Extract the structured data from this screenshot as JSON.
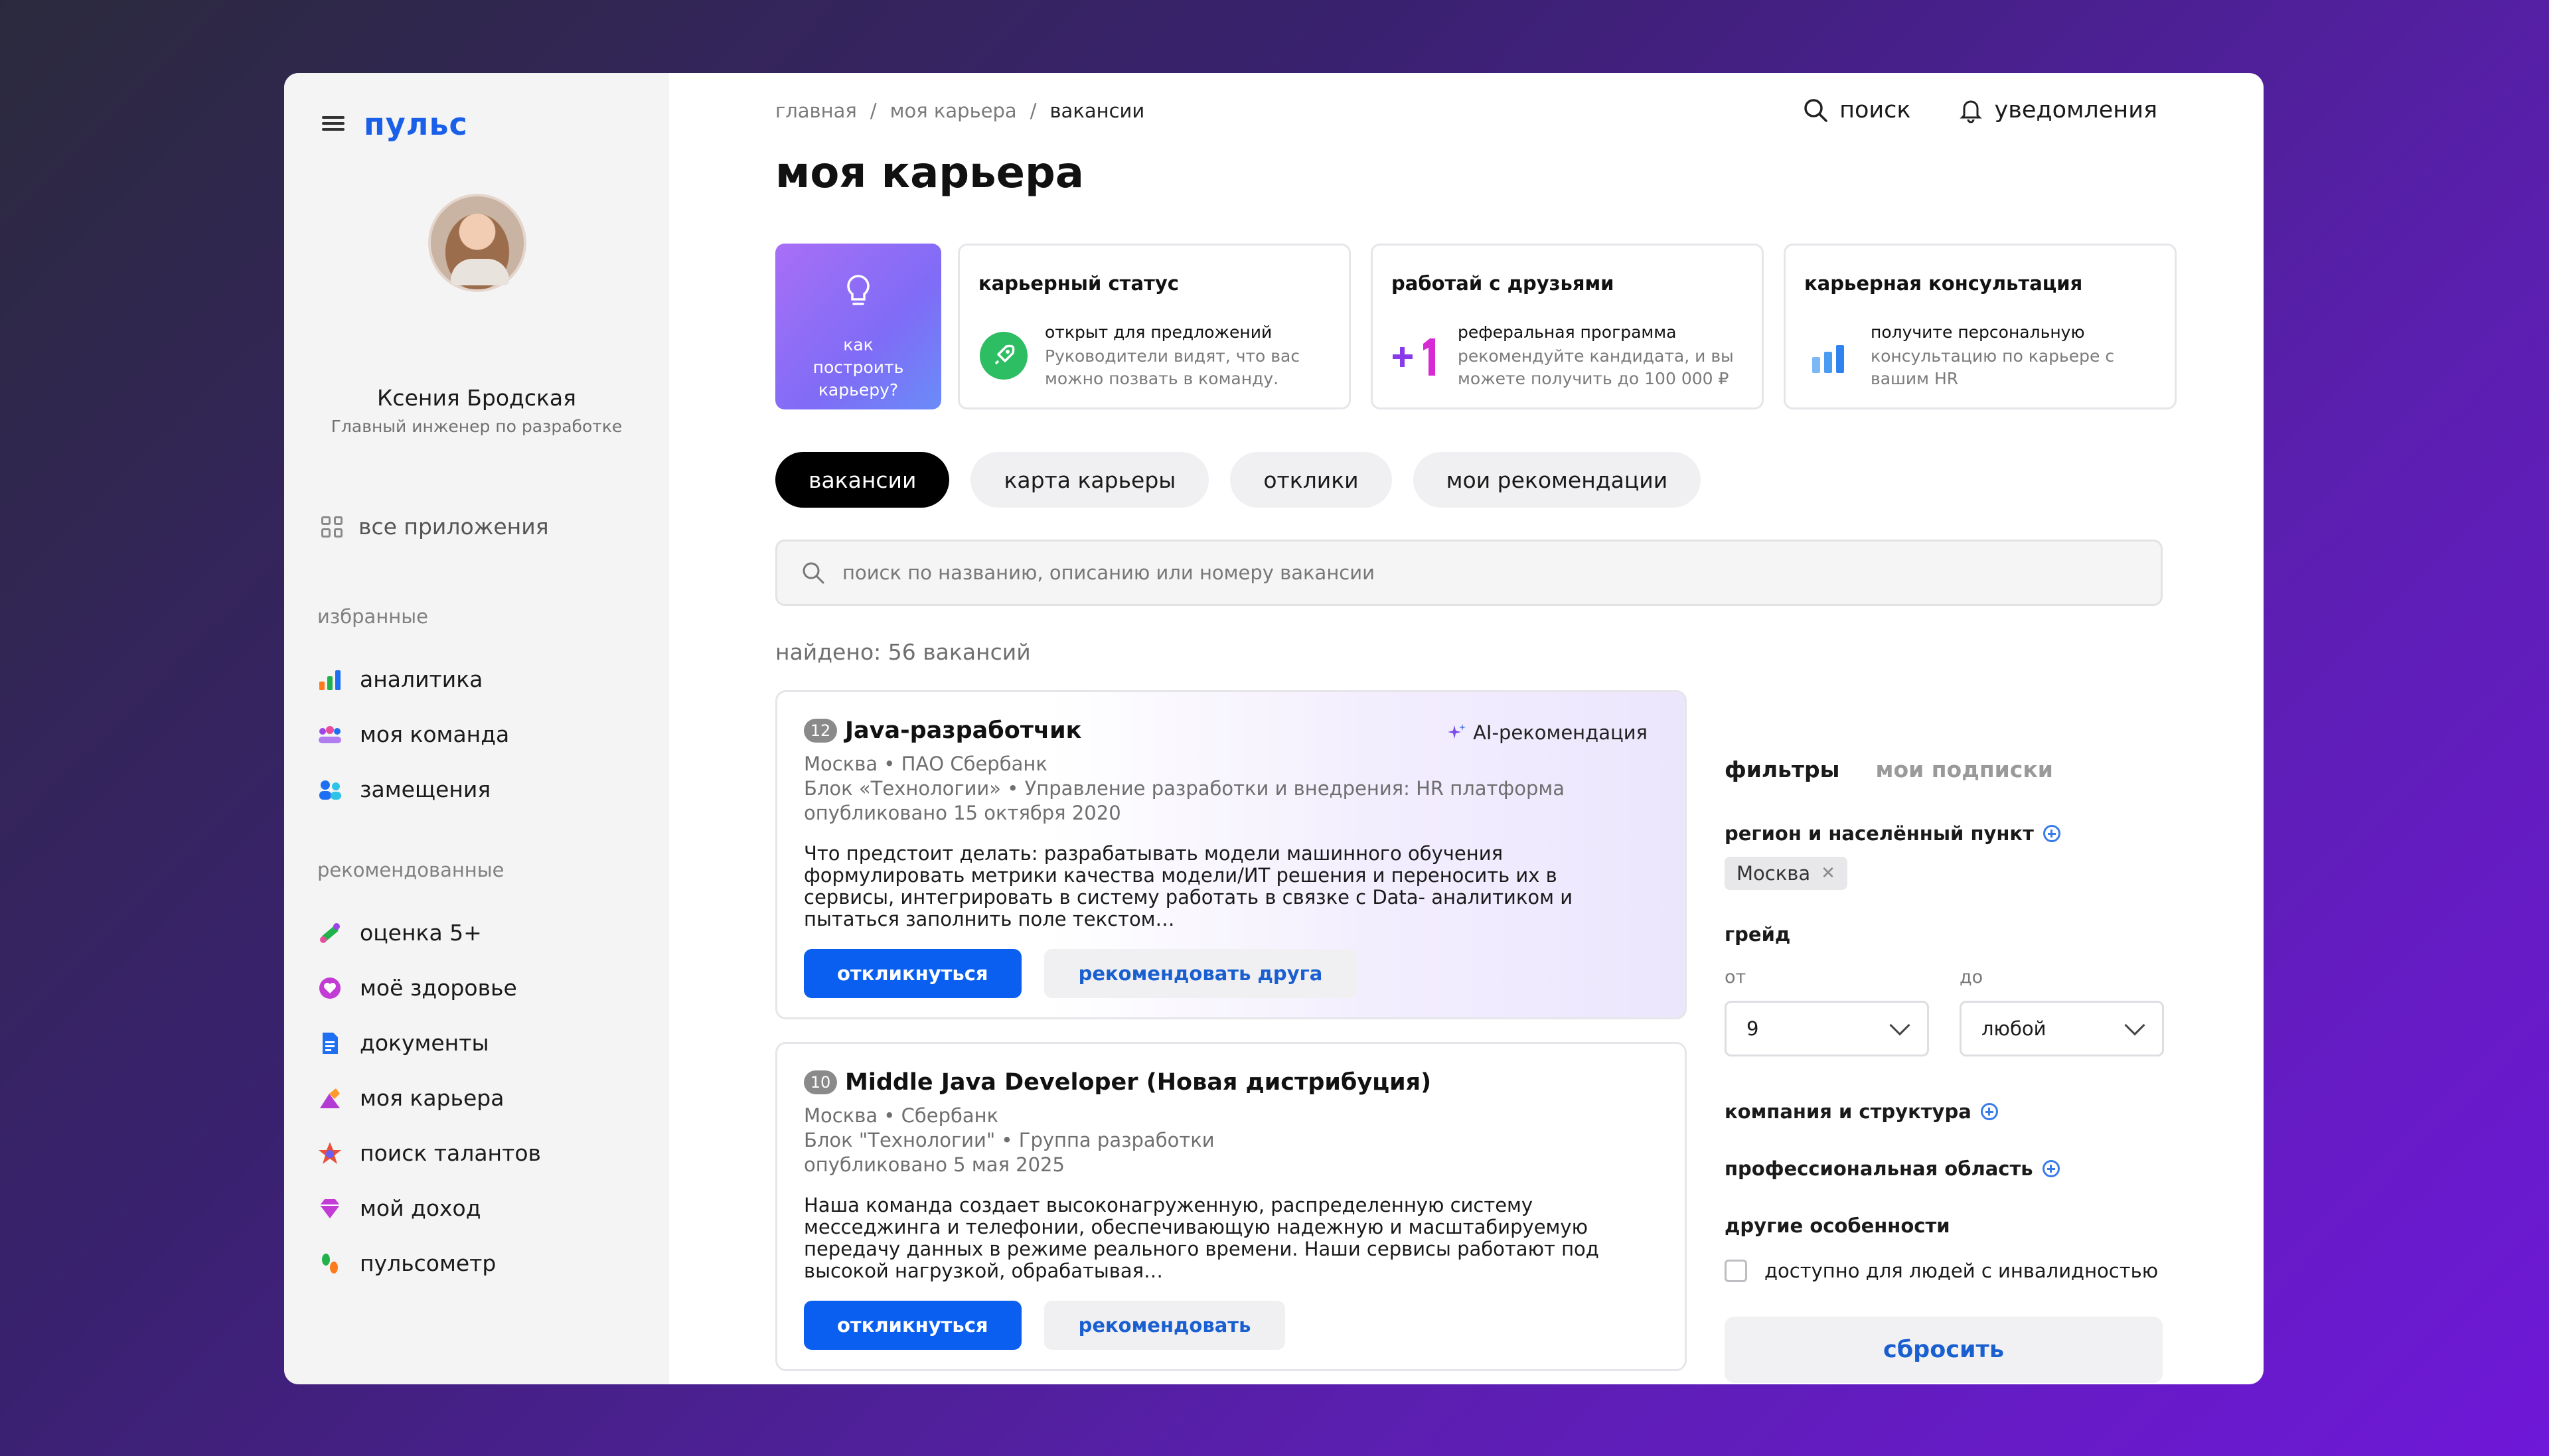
{
  "app": {
    "logo": "пульс"
  },
  "user": {
    "name": "Ксения Бродская",
    "role": "Главный инженер по разработке"
  },
  "sidebar": {
    "all_apps": "все приложения",
    "favorites_title": "избранные",
    "favorites": [
      {
        "label": "аналитика",
        "icon": "analytics-icon"
      },
      {
        "label": "моя команда",
        "icon": "team-icon"
      },
      {
        "label": "замещения",
        "icon": "substitution-icon"
      }
    ],
    "recommended_title": "рекомендованные",
    "recommended": [
      {
        "label": "оценка 5+",
        "icon": "rating-icon"
      },
      {
        "label": "моё здоровье",
        "icon": "health-icon"
      },
      {
        "label": "документы",
        "icon": "documents-icon"
      },
      {
        "label": "моя карьера",
        "icon": "career-icon"
      },
      {
        "label": "поиск талантов",
        "icon": "talent-icon"
      },
      {
        "label": "мой доход",
        "icon": "income-icon"
      },
      {
        "label": "пульсометр",
        "icon": "pulsometer-icon"
      }
    ]
  },
  "breadcrumb": {
    "home": "главная",
    "sep": "/",
    "career": "моя карьера",
    "current": "вакансии"
  },
  "header": {
    "search": "поиск",
    "notifications": "уведомления"
  },
  "page_title": "моя карьера",
  "promo": {
    "text": "как построить карьеру?"
  },
  "cards": [
    {
      "title": "карьерный статус",
      "line1": "открыт для предложений",
      "line2": "Руководители видят, что вас можно позвать в команду."
    },
    {
      "title": "работай с друзьями",
      "line1": "реферальная программа",
      "line2": "рекомендуйте кандидата, и вы можете получить до 100 000 ₽"
    },
    {
      "title": "карьерная консультация",
      "line1": "получите персональную",
      "line2": "консультацию по карьере с вашим HR"
    }
  ],
  "tabs": [
    "вакансии",
    "карта карьеры",
    "отклики",
    "мои рекомендации"
  ],
  "search": {
    "placeholder": "поиск по названию, описанию или номеру вакансии"
  },
  "found": "найдено: 56 вакансий",
  "jobs": [
    {
      "badge": "12",
      "title": "Java-разработчик",
      "ai_tag": "AI-рекомендация",
      "meta1": "Москва • ПАО Сбербанк",
      "meta2": "Блок «Технологии» • Управление разработки и внедрения: HR платформа",
      "meta3": "опубликовано 15 октября 2020",
      "desc": "Что предстоит делать: разрабатывать модели машинного обучения формулировать метрики качества модели/ИТ решения и переносить их в сервисы, интегрировать в систему работать в связке с Data- аналитиком и пытаться заполнить поле текстом…",
      "apply": "откликнуться",
      "recommend": "рекомендовать друга"
    },
    {
      "badge": "10",
      "title": "Middle Java Developer (Новая дистрибуция)",
      "meta1": "Москва • Сбербанк",
      "meta2": "Блок \"Технологии\" • Группа разработки",
      "meta3": "опубликовано 5 мая 2025",
      "desc": "Наша команда создает высоконагруженную, распределенную систему месседжинга и телефонии, обеспечивающую надежную и масштабируемую передачу данных в режиме реального времени. Наши сервисы работают под высокой нагрузкой, обрабатывая…",
      "apply": "откликнуться",
      "recommend": "рекомендовать"
    }
  ],
  "filters": {
    "tab_filters": "фильтры",
    "tab_subscriptions": "мои подписки",
    "region_label": "регион и населённый пункт",
    "region_chip": "Москва",
    "grade_label": "грейд",
    "from_label": "от",
    "to_label": "до",
    "from_value": "9",
    "to_value": "любой",
    "company_label": "компания и структура",
    "prof_label": "профессиональная область",
    "other_label": "другие особенности",
    "accessibility": "доступно для людей с инвалидностью",
    "reset": "сбросить"
  },
  "colors": {
    "accent": "#0a5ff0",
    "logo": "#1a5fe8"
  }
}
